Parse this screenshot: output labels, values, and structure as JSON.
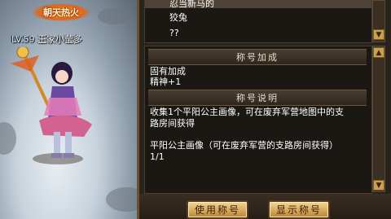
{
  "character": {
    "title": "朝天热火",
    "level_label": "LV.59",
    "name": "王家小莹多"
  },
  "title_list": {
    "items": [
      "忍当新马的",
      "狡兔",
      "??"
    ]
  },
  "detail": {
    "bonus_header": "称号加成",
    "bonus_lines": [
      "固有加成",
      "精神+1"
    ],
    "desc_header": "称号说明",
    "desc_lines": [
      "收集1个平阳公主画像，可在废弃军营地图中的支",
      "路房间获得"
    ],
    "requirement": "平阳公主画像（可在废弃军营的支路房间获得）",
    "progress": "1/1"
  },
  "buttons": {
    "use_title": "使用称号",
    "show_title": "显示称号"
  }
}
